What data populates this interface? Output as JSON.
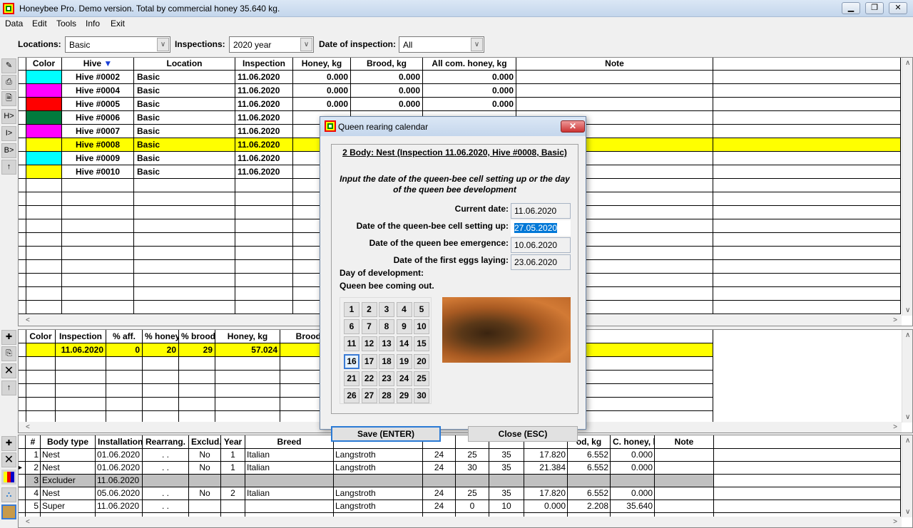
{
  "window": {
    "title": "Honeybee Pro. Demo version. Total by commercial honey 35.640 kg."
  },
  "menu": [
    "Data",
    "Edit",
    "Tools",
    "Info",
    "Exit"
  ],
  "filters": {
    "locations_label": "Locations:",
    "locations_value": "Basic",
    "inspections_label": "Inspections:",
    "inspections_value": "2020 year",
    "date_label": "Date of inspection:",
    "date_value": "All"
  },
  "hives": {
    "columns": [
      "Color",
      "Hive",
      "Location",
      "Inspection",
      "Honey, kg",
      "Brood, kg",
      "All com. honey, kg",
      "Note"
    ],
    "sort_indicator": "▼",
    "selected_row": 5,
    "rows": [
      {
        "color": "#00ffff",
        "hive": "Hive #0002",
        "location": "Basic",
        "inspection": "11.06.2020",
        "honey": "0.000",
        "brood": "0.000",
        "all": "0.000"
      },
      {
        "color": "#ff00ff",
        "hive": "Hive #0004",
        "location": "Basic",
        "inspection": "11.06.2020",
        "honey": "0.000",
        "brood": "0.000",
        "all": "0.000"
      },
      {
        "color": "#ff0000",
        "hive": "Hive #0005",
        "location": "Basic",
        "inspection": "11.06.2020",
        "honey": "0.000",
        "brood": "0.000",
        "all": "0.000"
      },
      {
        "color": "#007a3d",
        "hive": "Hive #0006",
        "location": "Basic",
        "inspection": "11.06.2020",
        "honey": "",
        "brood": "",
        "all": ""
      },
      {
        "color": "#ff00ff",
        "hive": "Hive #0007",
        "location": "Basic",
        "inspection": "11.06.2020",
        "honey": "",
        "brood": "",
        "all": ""
      },
      {
        "color": "#ffff00",
        "hive": "Hive #0008",
        "location": "Basic",
        "inspection": "11.06.2020",
        "honey": "",
        "brood": "",
        "all": ""
      },
      {
        "color": "#00ffff",
        "hive": "Hive #0009",
        "location": "Basic",
        "inspection": "11.06.2020",
        "honey": "",
        "brood": "",
        "all": ""
      },
      {
        "color": "#ffff00",
        "hive": "Hive #0010",
        "location": "Basic",
        "inspection": "11.06.2020",
        "honey": "",
        "brood": "",
        "all": ""
      }
    ]
  },
  "inspections": {
    "columns": [
      "Color",
      "Inspection",
      "% aff.",
      "% honey",
      "% brood",
      "Honey, kg",
      "Brood,",
      "ote"
    ],
    "rows": [
      {
        "color": "#ffff00",
        "inspection": "11.06.2020",
        "aff": "0",
        "honey_pct": "20",
        "brood_pct": "29",
        "honey": "57.024",
        "brood": "2"
      }
    ]
  },
  "bodies": {
    "columns": [
      "#",
      "Body type",
      "Installation",
      "Rearrang.",
      "Exclud.",
      "Year",
      "Breed",
      "",
      "",
      "",
      "",
      "",
      "od, kg",
      "C. honey, k",
      "Note"
    ],
    "current_row": 2,
    "rows": [
      [
        "1",
        "Nest",
        "01.06.2020",
        ". .",
        "No",
        "1",
        "Italian",
        "Langstroth",
        "24",
        "25",
        "35",
        "17.820",
        "6.552",
        "0.000",
        ""
      ],
      [
        "2",
        "Nest",
        "01.06.2020",
        ". .",
        "No",
        "1",
        "Italian",
        "Langstroth",
        "24",
        "30",
        "35",
        "21.384",
        "6.552",
        "0.000",
        ""
      ],
      [
        "3",
        "Excluder",
        "11.06.2020",
        "",
        "",
        "",
        "",
        "",
        "",
        "",
        "",
        "",
        "",
        "",
        ""
      ],
      [
        "4",
        "Nest",
        "05.06.2020",
        ". .",
        "No",
        "2",
        "Italian",
        "Langstroth",
        "24",
        "25",
        "35",
        "17.820",
        "6.552",
        "0.000",
        ""
      ],
      [
        "5",
        "Super",
        "11.06.2020",
        ". .",
        "",
        "",
        "",
        "Langstroth",
        "24",
        "0",
        "10",
        "0.000",
        "2.208",
        "35.640",
        ""
      ]
    ]
  },
  "toolbar_top": [
    "H>",
    "I>",
    "B>",
    "↑"
  ],
  "dialog": {
    "title": "Queen rearing calendar",
    "heading": "2 Body: Nest (Inspection 11.06.2020, Hive #0008, Basic)",
    "instruction": "Input the date of the queen-bee cell setting up or the day of the queen bee development",
    "current_date_label": "Current date:",
    "current_date": "11.06.2020",
    "cell_setup_label": "Date of the queen-bee cell setting up:",
    "cell_setup": "27.05.2020",
    "emergence_label": "Date of the queen bee emergence:",
    "emergence": "10.06.2020",
    "eggs_label": "Date of the first eggs laying:",
    "eggs": "23.06.2020",
    "day_label": "Day of development:",
    "status": "Queen bee coming out.",
    "days": [
      "1",
      "2",
      "3",
      "4",
      "5",
      "6",
      "7",
      "8",
      "9",
      "10",
      "11",
      "12",
      "13",
      "14",
      "15",
      "16",
      "17",
      "18",
      "19",
      "20",
      "21",
      "22",
      "23",
      "24",
      "25",
      "26",
      "27",
      "28",
      "29",
      "30"
    ],
    "selected_day": "16",
    "save_label": "Save (ENTER)",
    "close_label": "Close (ESC)"
  }
}
